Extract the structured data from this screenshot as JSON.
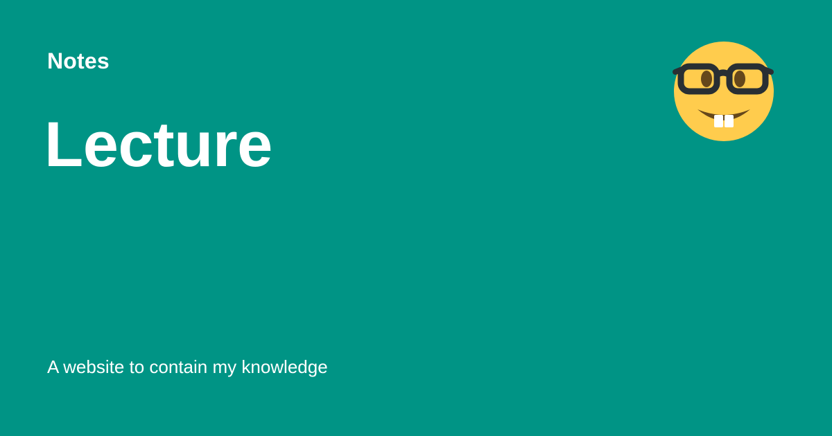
{
  "site": {
    "name": "Notes"
  },
  "page": {
    "title": "Lecture",
    "description": "A website to contain my knowledge"
  },
  "logo": {
    "icon": "nerd-face-emoji-icon"
  },
  "colors": {
    "background": "#009485",
    "text": "#ffffff",
    "emoji_face": "#FFCC4D",
    "emoji_features": "#65471B"
  }
}
